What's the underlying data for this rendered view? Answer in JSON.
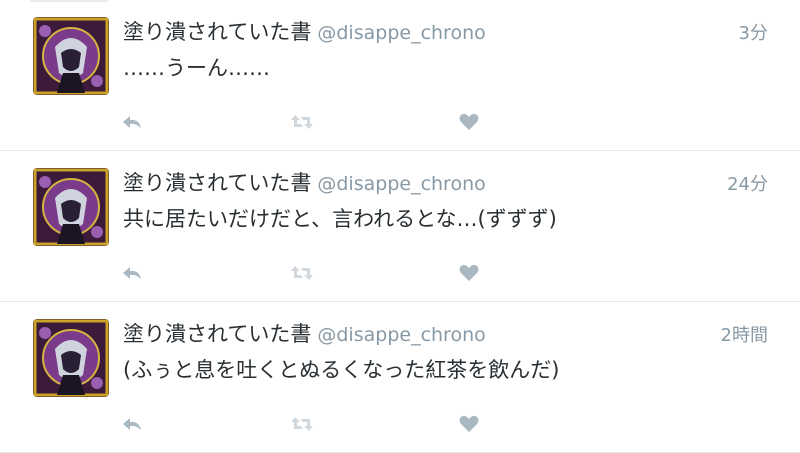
{
  "colors": {
    "name": "#292f33",
    "muted": "#8899a6",
    "action_icon": "#aab8c2",
    "divider": "#e1e8ed"
  },
  "tweets": [
    {
      "display_name": "塗り潰されていた書",
      "screen_name": "@disappe_chrono",
      "time": "3分",
      "text": "……うーん……",
      "icons": [
        "reply-icon",
        "retweet-icon",
        "like-heart-icon"
      ]
    },
    {
      "display_name": "塗り潰されていた書",
      "screen_name": "@disappe_chrono",
      "time": "24分",
      "text": "共に居たいだけだと、言われるとな…(ずずず)",
      "icons": [
        "reply-icon",
        "retweet-icon",
        "like-heart-icon"
      ]
    },
    {
      "display_name": "塗り潰されていた書",
      "screen_name": "@disappe_chrono",
      "time": "2時間",
      "text": "(ふぅと息を吐くとぬるくなった紅茶を飲んだ)",
      "icons": [
        "reply-icon",
        "retweet-icon",
        "like-heart-icon"
      ]
    }
  ]
}
